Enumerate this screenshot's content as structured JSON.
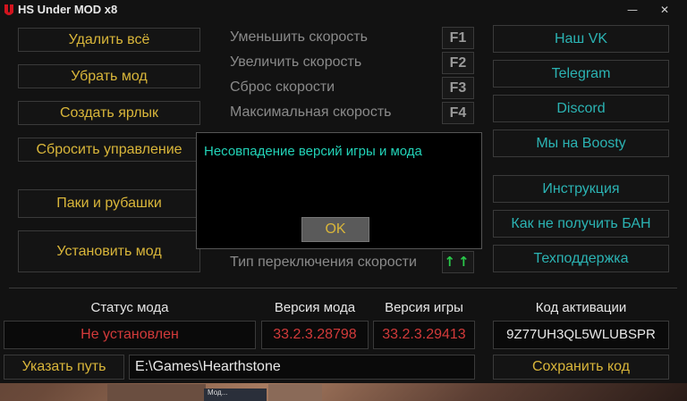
{
  "window": {
    "title": "HS Under MOD x8",
    "minimize_label": "—",
    "close_label": "✕"
  },
  "left_buttons": [
    {
      "label": "Удалить всё"
    },
    {
      "label": "Убрать мод"
    },
    {
      "label": "Создать ярлык"
    },
    {
      "label": "Сбросить управление"
    },
    {
      "label": "Паки и рубашки"
    },
    {
      "label": "Установить мод"
    }
  ],
  "hotkeys": [
    {
      "label": "Уменьшить скорость",
      "key": "F1"
    },
    {
      "label": "Увеличить скорость",
      "key": "F2"
    },
    {
      "label": "Сброс скорости",
      "key": "F3"
    },
    {
      "label": "Максимальная скорость",
      "key": "F4"
    }
  ],
  "switch_type": {
    "label": "Тип переключения скорости",
    "value": "↑↑"
  },
  "right_buttons": [
    {
      "label": "Наш VK"
    },
    {
      "label": "Telegram"
    },
    {
      "label": "Discord"
    },
    {
      "label": "Мы на Boosty"
    },
    {
      "label": "Инструкция"
    },
    {
      "label": "Как не получить БАН"
    },
    {
      "label": "Техподдержка"
    }
  ],
  "status": {
    "mod_status_header": "Статус мода",
    "mod_status_value": "Не установлен",
    "mod_version_header": "Версия мода",
    "mod_version_value": "33.2.3.28798",
    "game_version_header": "Версия игры",
    "game_version_value": "33.2.3.29413",
    "activation_header": "Код активации",
    "activation_value": "9Z77UH3QL5WLUBSPR"
  },
  "path": {
    "button_label": "Указать путь",
    "value": "E:\\Games\\Hearthstone"
  },
  "save_code_label": "Сохранить код",
  "dialog": {
    "message": "Несовпадение версий игры и мода",
    "ok_label": "OK"
  },
  "taskbar_thumb": {
    "text": "Мод..."
  },
  "colors": {
    "accent_gold": "#d9b63a",
    "accent_teal": "#2bb3b3",
    "error_red": "#d23a3a",
    "dialog_text": "#22d3b8"
  }
}
